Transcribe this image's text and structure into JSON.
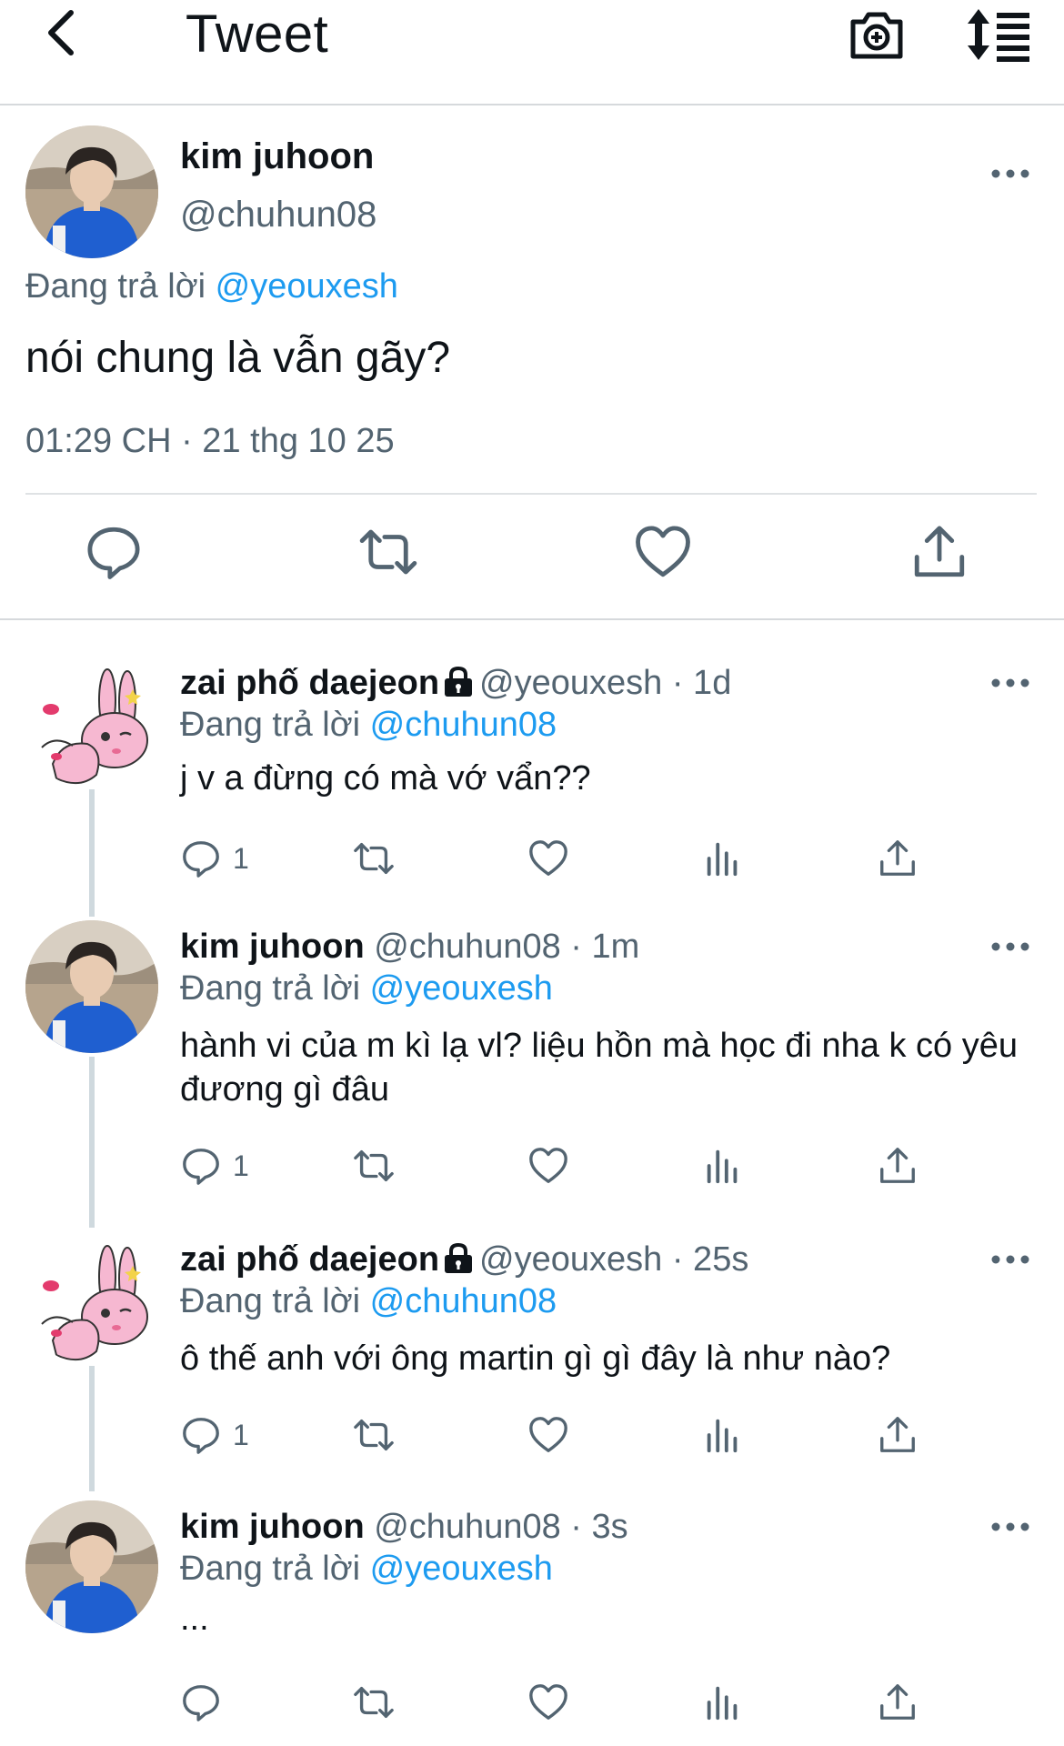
{
  "header": {
    "title": "Tweet"
  },
  "main_tweet": {
    "name": "kim juhoon",
    "handle": "@chuhun08",
    "replying_prefix": "Đang trả lời",
    "replying_to": "@yeouxesh",
    "text": "nói chung là vẫn gãy?",
    "timestamp": "01:29 CH · 21 thg 10 25"
  },
  "replies": [
    {
      "name": "zai phố daejeon",
      "meta": "@yeouxesh · 1d",
      "replying_prefix": "Đang trả lời",
      "replying_to": "@chuhun08",
      "text": "j v a đừng có mà vớ vẩn??",
      "reply_count": "1"
    },
    {
      "name": "kim juhoon",
      "meta": "@chuhun08 · 1m",
      "replying_prefix": "Đang trả lời",
      "replying_to": "@yeouxesh",
      "text": "hành vi của m kì lạ vl? liệu hồn mà học đi nha k có yêu đương gì đâu",
      "reply_count": "1"
    },
    {
      "name": "zai phố daejeon",
      "meta": "@yeouxesh · 25s",
      "replying_prefix": "Đang trả lời",
      "replying_to": "@chuhun08",
      "text": "ô thế anh với ông martin gì gì đây là như nào?",
      "reply_count": "1"
    },
    {
      "name": "kim juhoon",
      "meta": "@chuhun08 · 3s",
      "replying_prefix": "Đang trả lời",
      "replying_to": "@yeouxesh",
      "text": "...",
      "reply_count": ""
    }
  ],
  "colors": {
    "accent": "#1d9bf0",
    "secondary_text": "#536471",
    "avatar_shirt": "#1f5fd0",
    "bunny": "#f6b8d1"
  }
}
